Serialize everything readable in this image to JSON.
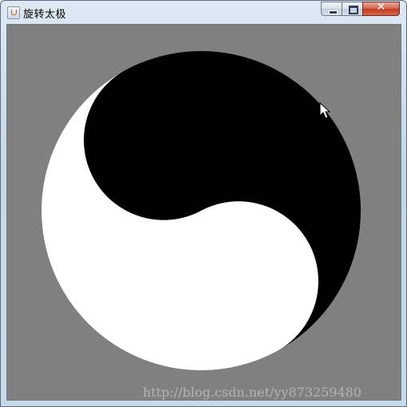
{
  "window": {
    "title": "旋转太极",
    "controls": {
      "minimize": "minimize",
      "maximize": "maximize",
      "close": "✕"
    }
  },
  "canvas": {
    "background": "#808080",
    "yin_color": "#000000",
    "yang_color": "#ffffff"
  },
  "watermark": "http://blog.csdn.net/yy873259480",
  "icons": [
    "java-app-icon",
    "minimize-icon",
    "maximize-icon",
    "close-icon",
    "mouse-cursor-icon"
  ]
}
